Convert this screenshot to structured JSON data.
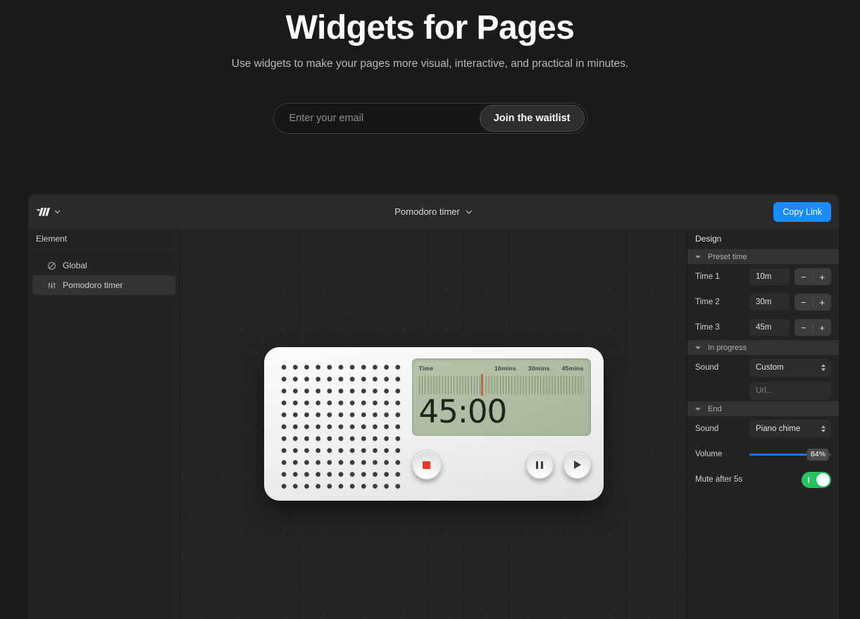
{
  "hero": {
    "title": "Widgets for Pages",
    "subtitle": "Use widgets to make your pages more visual, interactive, and practical in minutes.",
    "email_placeholder": "Enter your email",
    "email_value": "",
    "cta_label": "Join the waitlist"
  },
  "app": {
    "toolbar": {
      "logo_name": "logo-mark",
      "document_title": "Pomodoro timer",
      "copy_link_label": "Copy Link"
    },
    "sidebar": {
      "header": "Element",
      "items": [
        {
          "label": "Global",
          "icon": "ban-circle-icon",
          "active": false
        },
        {
          "label": "Pomodoro timer",
          "icon": "sliders-icon",
          "active": true
        }
      ]
    },
    "device": {
      "lcd": {
        "time_label": "Time",
        "ticks": [
          "10mins",
          "30mins",
          "45mins"
        ],
        "display": "45:00",
        "marker_percent": 38,
        "marker_color": "#e2473a"
      },
      "buttons": [
        {
          "name": "stop-button",
          "icon": "stop-icon"
        },
        {
          "name": "pause-button",
          "icon": "pause-icon"
        },
        {
          "name": "play-button",
          "icon": "play-icon"
        }
      ]
    },
    "panel": {
      "header": "Design",
      "sections": [
        {
          "title": "Preset time",
          "rows": [
            {
              "label": "Time 1",
              "value": "10m"
            },
            {
              "label": "Time 2",
              "value": "30m"
            },
            {
              "label": "Time 3",
              "value": "45m"
            }
          ],
          "minus_label": "−",
          "plus_label": "+"
        },
        {
          "title": "In progress",
          "sound_label": "Sound",
          "sound_value": "Custom",
          "url_placeholder": "Url..."
        },
        {
          "title": "End",
          "sound_label": "Sound",
          "sound_value": "Piano chime",
          "volume_label": "Volume",
          "volume_value": "84%",
          "volume_percent": 84,
          "mute_label": "Mute after 5s",
          "mute_on": true
        }
      ]
    }
  },
  "colors": {
    "accent_blue": "#1a8cff",
    "slider_blue": "#1a77e8",
    "toggle_green": "#22c55e",
    "lcd_green": "#aebba3",
    "stop_red": "#e8372c"
  }
}
